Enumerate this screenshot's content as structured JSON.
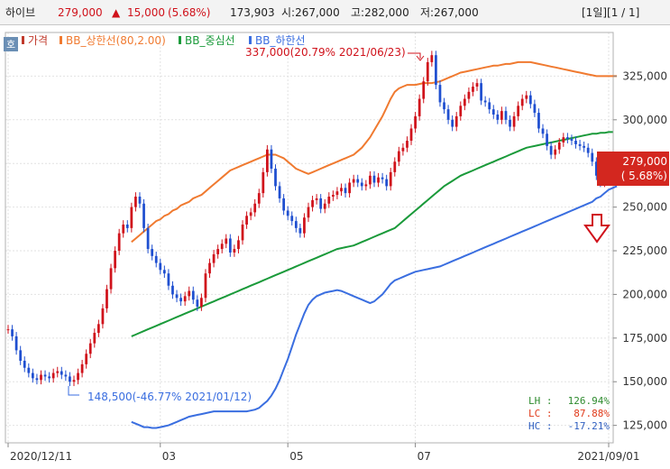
{
  "header": {
    "name": "하이브",
    "price": "279,000",
    "change_arrow": "▲",
    "change": "15,000",
    "change_pct": "(5.68%)",
    "volume": "173,903",
    "open": "시:267,000",
    "high": "고:282,000",
    "low": "저:267,000",
    "page_info": "[1일][1 / 1]"
  },
  "legend": {
    "toggle_label": "호",
    "items": [
      {
        "label": "가격",
        "color": "#c0392b"
      },
      {
        "label": "BB_상한선(80,2.00)",
        "color": "#f07a30"
      },
      {
        "label": "BB_중심선",
        "color": "#1a9a3a"
      },
      {
        "label": "BB_하한선",
        "color": "#3a6ee0"
      }
    ]
  },
  "annotations": {
    "high": "337,000(20.79% 2021/06/23)",
    "low": "148,500(-46.77% 2021/01/12)"
  },
  "current_price": {
    "value": "279,000",
    "pct": "( 5.68%)"
  },
  "stats": [
    {
      "label": "LH :",
      "value": "126.94%",
      "color": "#2e8b2e"
    },
    {
      "label": "LC :",
      "value": "87.88%",
      "color": "#e03a1a"
    },
    {
      "label": "HC :",
      "value": "-17.21%",
      "color": "#2f5fc0"
    }
  ],
  "colors": {
    "up": "#d0121b",
    "down": "#1f4fd0",
    "bb_upper": "#f07a30",
    "bb_mid": "#1a9a3a",
    "bb_lower": "#3a6ee0"
  },
  "chart_data": {
    "type": "line",
    "x_tick_labels": [
      "2020/12/11",
      "03",
      "05",
      "07",
      "2021/09/01"
    ],
    "y_ticks": [
      "125,000",
      "150,000",
      "175,000",
      "200,000",
      "225,000",
      "250,000",
      "275,000",
      "300,000",
      "325,000"
    ],
    "ylim": [
      115000,
      350000
    ],
    "price": [
      180000,
      176000,
      168000,
      162000,
      158000,
      155000,
      152000,
      151000,
      154000,
      153000,
      152000,
      155000,
      156000,
      154000,
      153000,
      150000,
      151000,
      155000,
      160000,
      166000,
      172000,
      178000,
      183000,
      192000,
      203000,
      215000,
      225000,
      235000,
      240000,
      238000,
      250000,
      256000,
      252000,
      238000,
      226000,
      222000,
      218000,
      214000,
      212000,
      205000,
      200000,
      198000,
      196000,
      199000,
      202000,
      197000,
      193000,
      198000,
      212000,
      218000,
      223000,
      226000,
      229000,
      232000,
      224000,
      226000,
      231000,
      240000,
      245000,
      247000,
      252000,
      258000,
      270000,
      283000,
      272000,
      262000,
      255000,
      248000,
      245000,
      242000,
      238000,
      235000,
      244000,
      250000,
      254000,
      255000,
      249000,
      252000,
      256000,
      257000,
      259000,
      261000,
      258000,
      264000,
      266000,
      264000,
      262000,
      263000,
      268000,
      264000,
      267000,
      266000,
      262000,
      270000,
      276000,
      282000,
      284000,
      288000,
      295000,
      302000,
      312000,
      322000,
      333000,
      337000,
      320000,
      310000,
      306000,
      300000,
      296000,
      302000,
      308000,
      312000,
      316000,
      319000,
      321000,
      311000,
      310000,
      306000,
      303000,
      300000,
      305000,
      300000,
      296000,
      302000,
      308000,
      312000,
      314000,
      309000,
      304000,
      295000,
      292000,
      285000,
      280000,
      283000,
      287000,
      290000,
      289000,
      288000,
      286000,
      285000,
      284000,
      281000,
      276000,
      268000,
      264000,
      272000,
      279000
    ],
    "bb_upper": [
      null,
      null,
      null,
      null,
      null,
      null,
      null,
      null,
      null,
      null,
      null,
      null,
      null,
      null,
      null,
      null,
      null,
      null,
      null,
      null,
      null,
      null,
      null,
      null,
      null,
      null,
      null,
      null,
      null,
      null,
      230000,
      232000,
      234000,
      236000,
      238000,
      240000,
      242000,
      243000,
      245000,
      246000,
      248000,
      249000,
      251000,
      252000,
      253000,
      255000,
      256000,
      257000,
      259000,
      261000,
      263000,
      265000,
      267000,
      269000,
      271000,
      272000,
      273000,
      274000,
      275000,
      276000,
      277000,
      278000,
      279000,
      280000,
      280000,
      280000,
      279000,
      278000,
      276000,
      274000,
      272000,
      271000,
      270000,
      269000,
      270000,
      271000,
      272000,
      273000,
      274000,
      275000,
      276000,
      277000,
      278000,
      279000,
      280000,
      282000,
      284000,
      287000,
      290000,
      294000,
      298000,
      302000,
      307000,
      312000,
      316000,
      318000,
      319000,
      320000,
      320000,
      320000,
      320500,
      321000,
      321000,
      321000,
      321500,
      322000,
      323000,
      324000,
      325000,
      326000,
      327000,
      327500,
      328000,
      328500,
      329000,
      329500,
      330000,
      330500,
      331000,
      331000,
      331500,
      332000,
      332000,
      332500,
      333000,
      333000,
      333000,
      333000,
      332500,
      332000,
      331500,
      331000,
      330500,
      330000,
      329500,
      329000,
      328500,
      328000,
      327500,
      327000,
      326500,
      326000,
      325500,
      325000,
      325000,
      325000,
      325000,
      325000,
      325000
    ],
    "bb_mid": [
      null,
      null,
      null,
      null,
      null,
      null,
      null,
      null,
      null,
      null,
      null,
      null,
      null,
      null,
      null,
      null,
      null,
      null,
      null,
      null,
      null,
      null,
      null,
      null,
      null,
      null,
      null,
      null,
      null,
      null,
      176000,
      177000,
      178000,
      179000,
      180000,
      181000,
      182000,
      183000,
      184000,
      185000,
      186000,
      187000,
      188000,
      189000,
      190000,
      191000,
      192000,
      193000,
      194000,
      195000,
      196000,
      197000,
      198000,
      199000,
      200000,
      201000,
      202000,
      203000,
      204000,
      205000,
      206000,
      207000,
      208000,
      209000,
      210000,
      211000,
      212000,
      213000,
      214000,
      215000,
      216000,
      217000,
      218000,
      219000,
      220000,
      221000,
      222000,
      223000,
      224000,
      225000,
      226000,
      226500,
      227000,
      227500,
      228000,
      229000,
      230000,
      231000,
      232000,
      233000,
      234000,
      235000,
      236000,
      237000,
      238000,
      240000,
      242000,
      244000,
      246000,
      248000,
      250000,
      252000,
      254000,
      256000,
      258000,
      260000,
      262000,
      263500,
      265000,
      266500,
      268000,
      269000,
      270000,
      271000,
      272000,
      273000,
      274000,
      275000,
      276000,
      277000,
      278000,
      279000,
      280000,
      281000,
      282000,
      283000,
      284000,
      284500,
      285000,
      285500,
      286000,
      286500,
      287000,
      287500,
      288000,
      288500,
      289000,
      289500,
      290000,
      290500,
      291000,
      291500,
      292000,
      292000,
      292500,
      292500,
      293000,
      293000
    ],
    "bb_lower": [
      null,
      null,
      null,
      null,
      null,
      null,
      null,
      null,
      null,
      null,
      null,
      null,
      null,
      null,
      null,
      null,
      null,
      null,
      null,
      null,
      null,
      null,
      null,
      null,
      null,
      null,
      null,
      null,
      null,
      null,
      127000,
      126000,
      125000,
      124000,
      124000,
      123500,
      123500,
      124000,
      124500,
      125000,
      126000,
      127000,
      128000,
      129000,
      130000,
      130500,
      131000,
      131500,
      132000,
      132500,
      133000,
      133000,
      133000,
      133000,
      133000,
      133000,
      133000,
      133000,
      133000,
      133500,
      134000,
      135000,
      137000,
      139000,
      142000,
      146000,
      151000,
      157000,
      163000,
      170000,
      177000,
      183000,
      189000,
      194000,
      197000,
      199000,
      200000,
      201000,
      201500,
      202000,
      202500,
      202000,
      201000,
      200000,
      199000,
      198000,
      197000,
      196000,
      195000,
      196000,
      198000,
      200000,
      203000,
      206000,
      208000,
      209000,
      210000,
      211000,
      212000,
      213000,
      213500,
      214000,
      214500,
      215000,
      215500,
      216000,
      217000,
      218000,
      219000,
      220000,
      221000,
      222000,
      223000,
      224000,
      225000,
      226000,
      227000,
      228000,
      229000,
      230000,
      231000,
      232000,
      233000,
      234000,
      235000,
      236000,
      237000,
      238000,
      239000,
      240000,
      241000,
      242000,
      243000,
      244000,
      245000,
      246000,
      247000,
      248000,
      249000,
      250000,
      251000,
      252000,
      253000,
      255000,
      256000,
      258000,
      260000,
      261000,
      262000
    ]
  }
}
